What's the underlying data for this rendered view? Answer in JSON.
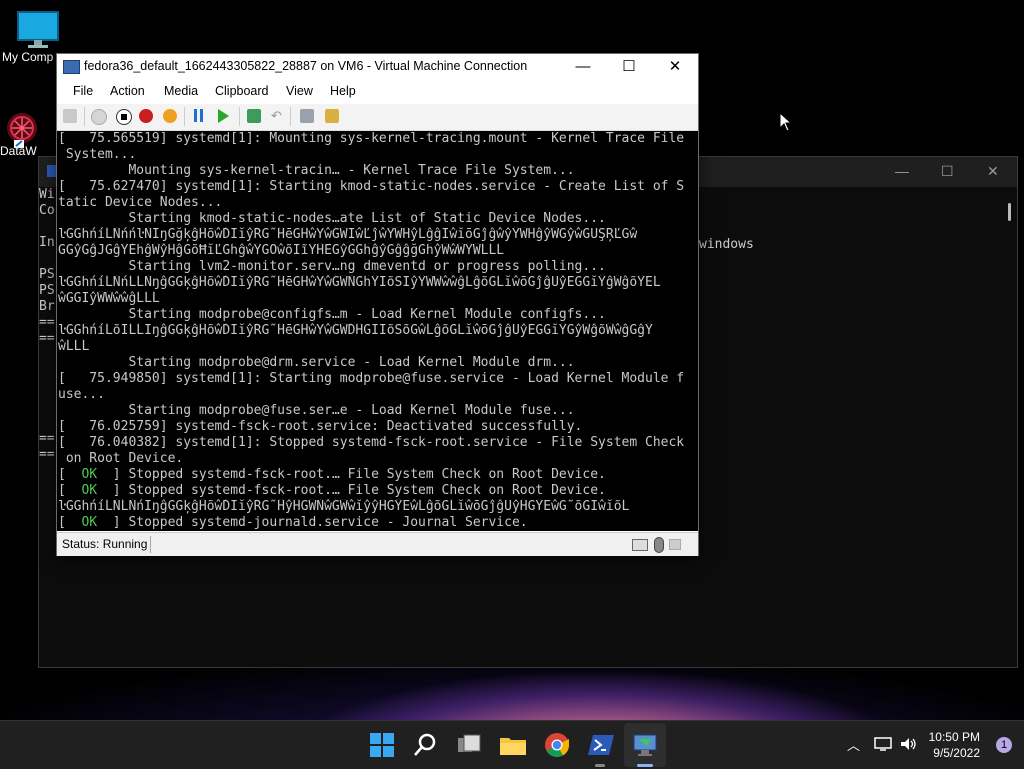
{
  "desktop": {
    "icons": [
      {
        "label": "My Comp"
      },
      {
        "label": "DataW"
      }
    ]
  },
  "bg_window": {
    "lines": [
      "Wi",
      "Co",
      "",
      "In",
      "",
      "PS",
      "PS",
      "Br",
      "==",
      "==",
      "",
      "",
      "",
      "",
      "",
      "",
      "==",
      "=="
    ],
    "right_text": "windows"
  },
  "vm_window": {
    "title": "fedora36_default_1662443305822_28887 on VM6 - Virtual Machine Connection",
    "controls": {
      "minimize": "—",
      "maximize": "☐",
      "close": "✕"
    },
    "menu": [
      "File",
      "Action",
      "Media",
      "Clipboard",
      "View",
      "Help"
    ],
    "console_lines": [
      {
        "pre": "[   75.565519] systemd[1]: Mounting sys-kernel-tracing.mount - Kernel Trace File",
        "ok": "",
        "post": ""
      },
      {
        "pre": " System...",
        "ok": "",
        "post": ""
      },
      {
        "pre": "         Mounting sys-kernel-tracin… - Kernel Trace File System...",
        "ok": "",
        "post": ""
      },
      {
        "pre": "[   75.627470] systemd[1]: Starting kmod-static-nodes.service - Create List of S",
        "ok": "",
        "post": ""
      },
      {
        "pre": "tatic Device Nodes...",
        "ok": "",
        "post": ""
      },
      {
        "pre": "         Starting kmod-static-nodes…ate List of Static Device Nodes...",
        "ok": "",
        "post": ""
      },
      {
        "pre": "ŀĜĜĥńíĹŇńńŀŇĬŋĜğķĝĤõŵĎĬĭŷŔĜ˜ĤēĜĤŵŸŵĜŴĨŵĽĵŵŶŴĤŷĹĝĝĨŵĭōĜĵĝŵŷŶŴĤĝŷŴĜŷŵĜŨŞŖĽĜŵ",
        "ok": "",
        "post": ""
      },
      {
        "pre": "ĜĜŷĜĝĴĜĝŶĚĥĝŴŷĤĝĜõĦĭĽĜĥĝŵŶĜŎŵõĨĩŸĤĔĜŷĜĜĥĝŷĜĝĝğĜĥŷŴŵŴŶŴĹĹĹ",
        "ok": "",
        "post": ""
      },
      {
        "pre": "         Starting lvm2-monitor.serv…ng dmeventd or progress polling...",
        "ok": "",
        "post": ""
      },
      {
        "pre": "ŀĜĜĥńíĹŇńĹĹŇŋĝĜĞķĝĤõŵĎĬĭŷŔĜ˜ĤēĜĤŵŸŵĜŴŇĜĥŶĬõŠĬŷŶŴŴŵŵĝĹĝõĜĹĭŵōĜĵĝŬŷĔĜĜĭŶĝŴĝõŶĔĹ",
        "ok": "",
        "post": ""
      },
      {
        "pre": "ŵĜĜĬŷŴŴŵŵĝĹĹĹ",
        "ok": "",
        "post": ""
      },
      {
        "pre": "         Starting modprobe@configfs…m - Load Kernel Module configfs...",
        "ok": "",
        "post": ""
      },
      {
        "pre": "ŀĜĜĥńíĹõĬĹĹĬŋĝĜĞķĝĤõŵĎĬĭŷŔĜ˜ĤēĜĤŵŸŵĜŴĎĤĜĬĨõŠõĜŵĹĝõĜĹĭŵōĜĵĝŬŷĔĜĜĭŶĜŷŴĝõŴŵĝĜĝŶ",
        "ok": "",
        "post": ""
      },
      {
        "pre": "ŵĹĹĹ",
        "ok": "",
        "post": ""
      },
      {
        "pre": "         Starting modprobe@drm.service - Load Kernel Module drm...",
        "ok": "",
        "post": ""
      },
      {
        "pre": "[   75.949850] systemd[1]: Starting modprobe@fuse.service - Load Kernel Module f",
        "ok": "",
        "post": ""
      },
      {
        "pre": "use...",
        "ok": "",
        "post": ""
      },
      {
        "pre": "         Starting modprobe@fuse.ser…e - Load Kernel Module fuse...",
        "ok": "",
        "post": ""
      },
      {
        "pre": "[   76.025759] systemd-fsck-root.service: Deactivated successfully.",
        "ok": "",
        "post": ""
      },
      {
        "pre": "[   76.040382] systemd[1]: Stopped systemd-fsck-root.service - File System Check",
        "ok": "",
        "post": ""
      },
      {
        "pre": " on Root Device.",
        "ok": "",
        "post": ""
      },
      {
        "pre": "[  ",
        "ok": "OK",
        "post": "  ] Stopped systemd-fsck-root.… File System Check on Root Device."
      },
      {
        "pre": "[  ",
        "ok": "OK",
        "post": "  ] Stopped systemd-fsck-root.… File System Check on Root Device."
      },
      {
        "pre": "ŀĜĜĥńíĹŇĹŇńĬŋĝĜĞķĝĤõŵĎĬĭŷŔĜ˜ĤŷĤĜŴŇŵĜŴŵĭŷŷĤĜŶĔŵĹĝõĜĹĭŵōĜĵĝŬŷĤĜŶĔŵĜ˜õĜĬŵĭõĹ",
        "ok": "",
        "post": ""
      },
      {
        "pre": "[  ",
        "ok": "OK",
        "post": "  ] Stopped systemd-journald.service - Journal Service."
      }
    ],
    "status": "Status: Running"
  },
  "taskbar": {
    "time": "10:50 PM",
    "date": "9/5/2022",
    "notification_count": "1"
  }
}
